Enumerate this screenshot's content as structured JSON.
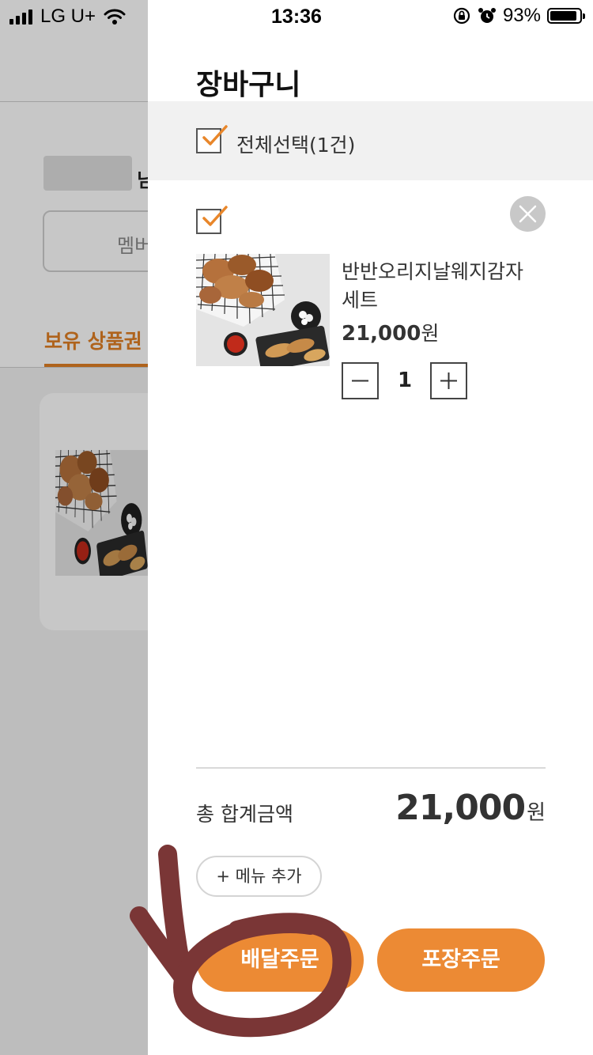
{
  "status_bar": {
    "carrier": "LG U+",
    "time": "13:36",
    "battery_percent": "93%",
    "battery_level": 0.93,
    "icons": [
      "signal-icon",
      "wifi-icon",
      "rotation-lock-icon",
      "alarm-icon",
      "battery-icon"
    ]
  },
  "background_page": {
    "name_suffix": "님",
    "member_button_label": "멤버",
    "tab_label": "보유 상품권"
  },
  "cart": {
    "title": "장바구니",
    "select_all_label": "전체선택(1건)",
    "items": [
      {
        "name": "반반오리지날웨지감자 세트",
        "price": "21,000",
        "currency": "원",
        "quantity": "1"
      }
    ],
    "total_label": "총 합계금액",
    "total_amount": "21,000",
    "total_currency": "원",
    "add_menu_label": "+ 메뉴 추가",
    "delivery_order_label": "배달주문",
    "takeout_order_label": "포장주문"
  },
  "colors": {
    "accent": "#ec8a34",
    "tab_accent": "#e07f25",
    "check": "#e8862a",
    "annotation": "#7a3636"
  }
}
